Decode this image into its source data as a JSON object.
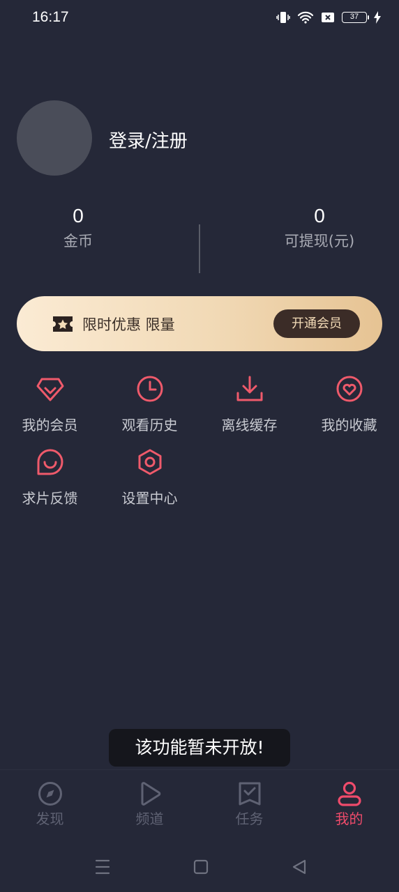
{
  "status_bar": {
    "time": "16:17",
    "battery": "37",
    "icons": [
      "vibrate-icon",
      "wifi-icon",
      "sim-off-icon",
      "battery-icon",
      "charging-icon"
    ]
  },
  "profile": {
    "login_label": "登录/注册"
  },
  "stats": {
    "coins": {
      "value": "0",
      "label": "金币"
    },
    "withdrawable": {
      "value": "0",
      "label": "可提现(元)"
    }
  },
  "vip_banner": {
    "promo_text": "限时优惠 限量",
    "button_label": "开通会员",
    "colors": {
      "gradient_start": "#fbebd4",
      "gradient_end": "#e6c393",
      "button_bg": "#3b2c27"
    }
  },
  "menu": {
    "items": [
      {
        "label": "我的会员",
        "icon": "diamond-icon"
      },
      {
        "label": "观看历史",
        "icon": "clock-icon"
      },
      {
        "label": "离线缓存",
        "icon": "download-icon"
      },
      {
        "label": "我的收藏",
        "icon": "heart-icon"
      },
      {
        "label": "求片反馈",
        "icon": "feedback-icon"
      },
      {
        "label": "设置中心",
        "icon": "settings-icon"
      }
    ],
    "accent_color": "#ef4b6b"
  },
  "toast": {
    "message": "该功能暂未开放!"
  },
  "bottom_nav": {
    "items": [
      {
        "label": "发现",
        "icon": "compass-icon",
        "active": false
      },
      {
        "label": "频道",
        "icon": "play-icon",
        "active": false
      },
      {
        "label": "任务",
        "icon": "task-icon",
        "active": false
      },
      {
        "label": "我的",
        "icon": "user-icon",
        "active": true
      }
    ]
  },
  "system_nav": {
    "buttons": [
      "menu-icon",
      "home-icon",
      "back-icon"
    ]
  }
}
